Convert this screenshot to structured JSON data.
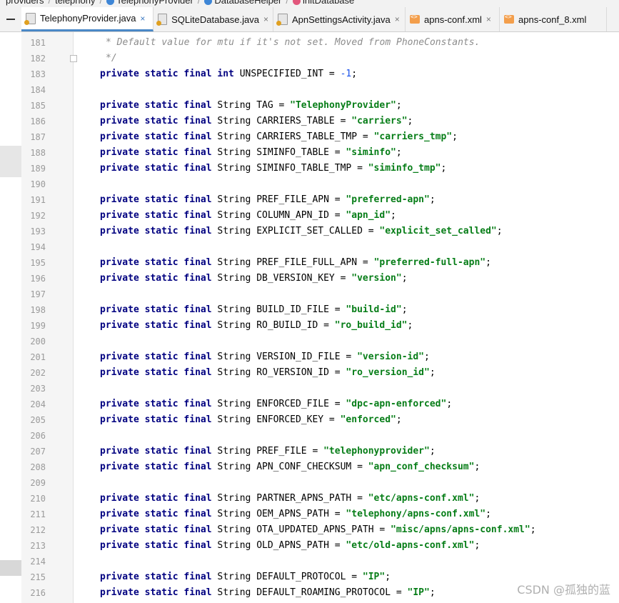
{
  "breadcrumb": [
    {
      "label": "providers",
      "icon": "none"
    },
    {
      "label": "telephony",
      "icon": "none"
    },
    {
      "label": "TelephonyProvider",
      "icon": "class-icon"
    },
    {
      "label": "DatabaseHelper",
      "icon": "class-icon"
    },
    {
      "label": "initDatabase",
      "icon": "method-icon"
    }
  ],
  "tabs": [
    {
      "label": "TelephonyProvider.java",
      "icon": "java-file-icon",
      "active": true
    },
    {
      "label": "SQLiteDatabase.java",
      "icon": "java-file-icon",
      "active": false
    },
    {
      "label": "ApnSettingsActivity.java",
      "icon": "java-file-icon",
      "active": false
    },
    {
      "label": "apns-conf.xml",
      "icon": "xml-file-icon",
      "active": false
    },
    {
      "label": "apns-conf_8.xml",
      "icon": "xml-file-icon",
      "active": false
    }
  ],
  "close_glyph": "×",
  "lines": [
    {
      "n": "181",
      "t": "c",
      "text": "* Default value for mtu if it's not set. Moved from PhoneConstants."
    },
    {
      "n": "182",
      "t": "c",
      "text": "*/"
    },
    {
      "n": "183",
      "t": "int",
      "name": "UNSPECIFIED_INT = ",
      "val": "-1"
    },
    {
      "n": "184",
      "t": "blank"
    },
    {
      "n": "185",
      "t": "str",
      "name": "TAG = ",
      "val": "\"TelephonyProvider\""
    },
    {
      "n": "186",
      "t": "str",
      "name": "CARRIERS_TABLE = ",
      "val": "\"carriers\""
    },
    {
      "n": "187",
      "t": "str",
      "name": "CARRIERS_TABLE_TMP = ",
      "val": "\"carriers_tmp\""
    },
    {
      "n": "188",
      "t": "str",
      "name": "SIMINFO_TABLE = ",
      "val": "\"siminfo\""
    },
    {
      "n": "189",
      "t": "str",
      "name": "SIMINFO_TABLE_TMP = ",
      "val": "\"siminfo_tmp\""
    },
    {
      "n": "190",
      "t": "blank"
    },
    {
      "n": "191",
      "t": "str",
      "name": "PREF_FILE_APN = ",
      "val": "\"preferred-apn\""
    },
    {
      "n": "192",
      "t": "str",
      "name": "COLUMN_APN_ID = ",
      "val": "\"apn_id\""
    },
    {
      "n": "193",
      "t": "str",
      "name": "EXPLICIT_SET_CALLED = ",
      "val": "\"explicit_set_called\""
    },
    {
      "n": "194",
      "t": "blank"
    },
    {
      "n": "195",
      "t": "str",
      "name": "PREF_FILE_FULL_APN = ",
      "val": "\"preferred-full-apn\""
    },
    {
      "n": "196",
      "t": "str",
      "name": "DB_VERSION_KEY = ",
      "val": "\"version\""
    },
    {
      "n": "197",
      "t": "blank"
    },
    {
      "n": "198",
      "t": "str",
      "name": "BUILD_ID_FILE = ",
      "val": "\"build-id\""
    },
    {
      "n": "199",
      "t": "str",
      "name": "RO_BUILD_ID = ",
      "val": "\"ro_build_id\""
    },
    {
      "n": "200",
      "t": "blank"
    },
    {
      "n": "201",
      "t": "str",
      "name": "VERSION_ID_FILE = ",
      "val": "\"version-id\""
    },
    {
      "n": "202",
      "t": "str",
      "name": "RO_VERSION_ID = ",
      "val": "\"ro_version_id\""
    },
    {
      "n": "203",
      "t": "blank"
    },
    {
      "n": "204",
      "t": "str",
      "name": "ENFORCED_FILE = ",
      "val": "\"dpc-apn-enforced\""
    },
    {
      "n": "205",
      "t": "str",
      "name": "ENFORCED_KEY = ",
      "val": "\"enforced\""
    },
    {
      "n": "206",
      "t": "blank"
    },
    {
      "n": "207",
      "t": "str",
      "name": "PREF_FILE = ",
      "val": "\"telephonyprovider\""
    },
    {
      "n": "208",
      "t": "str",
      "name": "APN_CONF_CHECKSUM = ",
      "val": "\"apn_conf_checksum\""
    },
    {
      "n": "209",
      "t": "blank"
    },
    {
      "n": "210",
      "t": "str",
      "name": "PARTNER_APNS_PATH = ",
      "val": "\"etc/apns-conf.xml\""
    },
    {
      "n": "211",
      "t": "str",
      "name": "OEM_APNS_PATH = ",
      "val": "\"telephony/apns-conf.xml\""
    },
    {
      "n": "212",
      "t": "str",
      "name": "OTA_UPDATED_APNS_PATH = ",
      "val": "\"misc/apns/apns-conf.xml\""
    },
    {
      "n": "213",
      "t": "str",
      "name": "OLD_APNS_PATH = ",
      "val": "\"etc/old-apns-conf.xml\""
    },
    {
      "n": "214",
      "t": "blank"
    },
    {
      "n": "215",
      "t": "str",
      "name": "DEFAULT_PROTOCOL = ",
      "val": "\"IP\""
    },
    {
      "n": "216",
      "t": "str",
      "name": "DEFAULT_ROAMING_PROTOCOL = ",
      "val": "\"IP\""
    }
  ],
  "kw": {
    "private": "private",
    "static": "static",
    "final": "final",
    "int": "int",
    "String": "String"
  },
  "watermark": "CSDN @孤独的蓝"
}
